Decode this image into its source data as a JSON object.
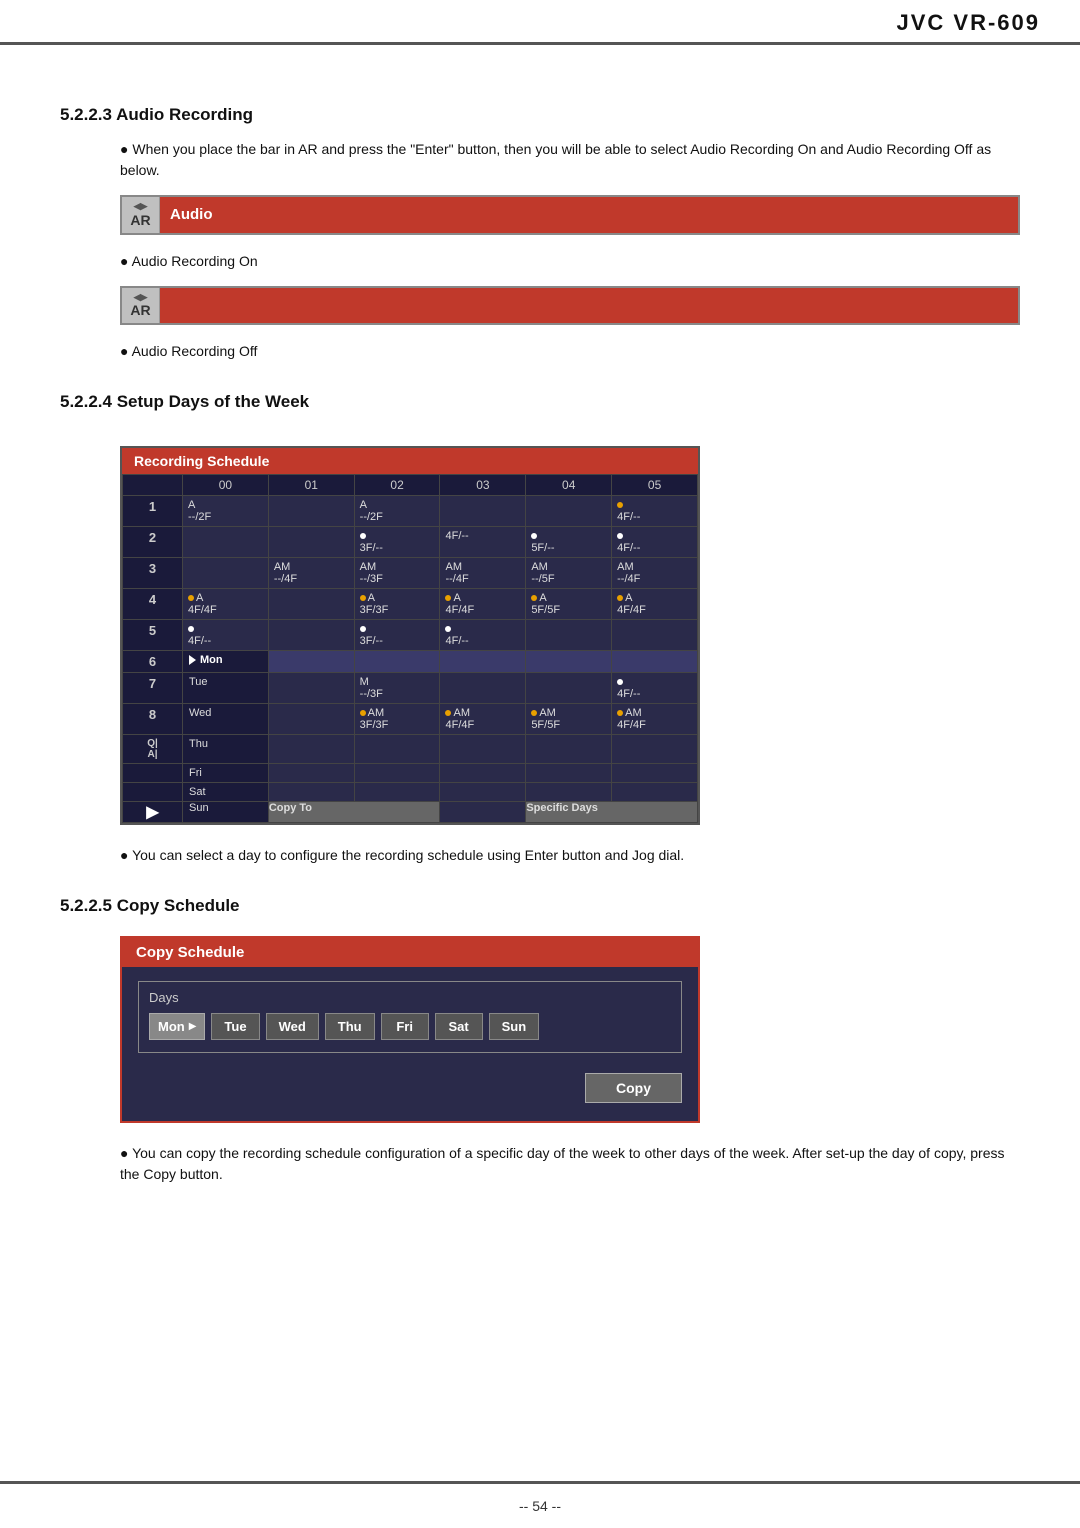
{
  "brand": "JVC VR-609",
  "page_number": "-- 54 --",
  "section_522_3": {
    "heading": "5.2.2.3  Audio Recording",
    "bullet1": "When you place the bar in AR and press the \"Enter\" button, then you will be able to select Audio Recording On and Audio Recording Off as below.",
    "ar_label_top": "AR",
    "ar_bar_audio_text": "Audio",
    "ar_label_on": "AR",
    "bullet_on": "Audio Recording On",
    "bullet_off": "Audio Recording Off"
  },
  "section_522_4": {
    "heading": "5.2.2.4  Setup Days of the Week",
    "schedule_title": "Recording Schedule",
    "col_headers": [
      "",
      "00",
      "01",
      "02",
      "03",
      "04",
      "05"
    ],
    "rows": [
      {
        "label": "1",
        "cells": [
          "A\n--/2F",
          "",
          "A\n--/2F",
          "",
          "",
          "●\n4F/--"
        ]
      },
      {
        "label": "2",
        "cells": [
          "",
          "",
          "●\n3F/--",
          "4F/--",
          "●\n5F/--",
          "●\n4F/--"
        ]
      },
      {
        "label": "3",
        "cells": [
          "",
          "AM\n--/4F",
          "AM\n--/3F",
          "AM\n--/4F",
          "AM\n--/5F",
          "AM\n--/4F"
        ]
      },
      {
        "label": "4",
        "cells": [
          "●A\n4F/4F",
          "",
          "●A\n3F/3F",
          "●A\n4F/4F",
          "●A\n5F/5F",
          "●A\n4F/4F"
        ]
      },
      {
        "label": "5",
        "cells": [
          "●\n4F/--",
          "",
          "●\n3F/--",
          "●\n4F/--",
          "",
          ""
        ]
      }
    ],
    "day_rows": [
      {
        "num": "6",
        "day": "Mon",
        "selected": true,
        "cells": [
          "",
          "",
          "",
          "",
          ""
        ]
      },
      {
        "num": "7",
        "day": "Tue",
        "cells": [
          "",
          "M\n--/3F",
          "",
          "",
          "●\n4F/--"
        ]
      },
      {
        "num": "8",
        "day": "Wed",
        "cells": [
          "",
          "●AM\n3F/3F",
          "●AM\n4F/4F",
          "●AM\n5F/5F",
          "●AM\n4F/4F"
        ]
      },
      {
        "num": "",
        "day": "Thu",
        "cells": [
          "",
          "",
          "",
          "",
          ""
        ]
      },
      {
        "num": "",
        "day": "Fri",
        "cells": [
          "",
          "",
          "",
          "",
          ""
        ]
      },
      {
        "num": "",
        "day": "Sat",
        "cells": [
          "",
          "",
          "",
          "",
          ""
        ]
      },
      {
        "num": "",
        "day": "Sun",
        "cells": [
          "Copy To",
          "",
          "",
          "Specific Days",
          ""
        ]
      }
    ],
    "copy_to_label": "Copy To",
    "specific_days_label": "Specific Days",
    "bullet1": "You can select a day to configure the recording schedule using Enter button and Jog dial."
  },
  "section_522_5": {
    "heading": "5.2.2.5  Copy Schedule",
    "title": "Copy Schedule",
    "days_label": "Days",
    "day_buttons": [
      "Mon",
      "Tue",
      "Wed",
      "Thu",
      "Fri",
      "Sat",
      "Sun"
    ],
    "selected_day": "Mon",
    "copy_button": "Copy",
    "bullet1": "You can copy the recording schedule configuration of a specific day of the week to other days of the week. After set-up the day of copy, press the Copy button."
  }
}
